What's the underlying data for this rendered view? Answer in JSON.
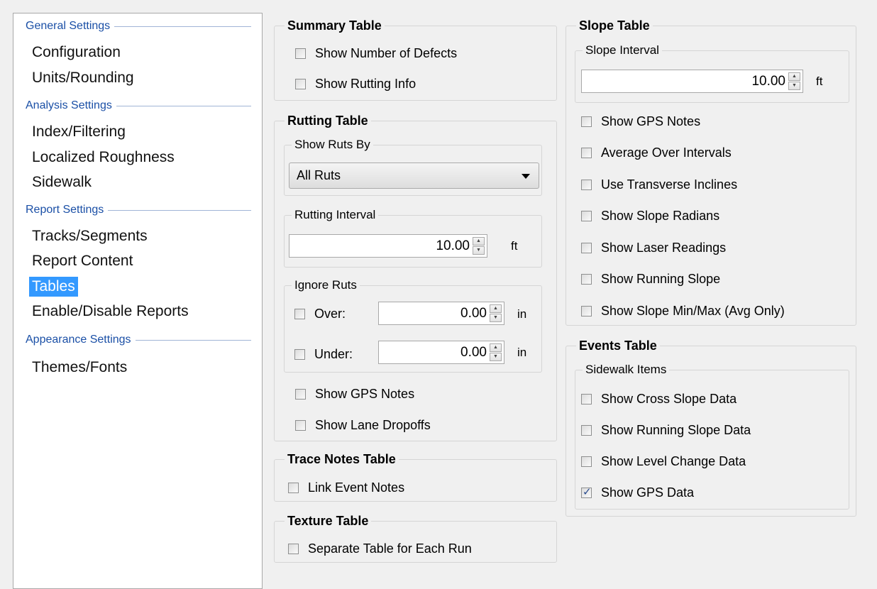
{
  "nav": {
    "sections": [
      {
        "heading": "General Settings",
        "items": [
          "Configuration",
          "Units/Rounding"
        ]
      },
      {
        "heading": "Analysis Settings",
        "items": [
          "Index/Filtering",
          "Localized Roughness",
          "Sidewalk"
        ]
      },
      {
        "heading": "Report Settings",
        "items": [
          "Tracks/Segments",
          "Report Content",
          "Tables",
          "Enable/Disable Reports"
        ]
      },
      {
        "heading": "Appearance Settings",
        "items": [
          "Themes/Fonts"
        ]
      }
    ],
    "selected": "Tables"
  },
  "summary": {
    "title": "Summary Table",
    "show_defects": "Show Number of Defects",
    "show_rutting": "Show Rutting Info"
  },
  "rutting": {
    "title": "Rutting Table",
    "show_by_title": "Show Ruts By",
    "show_by_value": "All Ruts",
    "interval_title": "Rutting Interval",
    "interval_value": "10.00",
    "interval_unit": "ft",
    "ignore_title": "Ignore Ruts",
    "over_label": "Over:",
    "over_value": "0.00",
    "over_unit": "in",
    "under_label": "Under:",
    "under_value": "0.00",
    "under_unit": "in",
    "show_gps": "Show GPS Notes",
    "show_dropoffs": "Show Lane Dropoffs"
  },
  "trace": {
    "title": "Trace Notes Table",
    "link_notes": "Link Event Notes"
  },
  "texture": {
    "title": "Texture Table",
    "separate": "Separate Table for Each Run"
  },
  "slope": {
    "title": "Slope Table",
    "interval_title": "Slope Interval",
    "interval_value": "10.00",
    "interval_unit": "ft",
    "items": [
      {
        "label": "Show GPS Notes",
        "checked": false
      },
      {
        "label": "Average Over Intervals",
        "checked": false
      },
      {
        "label": "Use Transverse Inclines",
        "checked": false
      },
      {
        "label": "Show Slope Radians",
        "checked": false
      },
      {
        "label": "Show Laser Readings",
        "checked": false
      },
      {
        "label": "Show Running Slope",
        "checked": false
      },
      {
        "label": "Show Slope Min/Max (Avg Only)",
        "checked": false
      }
    ]
  },
  "events": {
    "title": "Events Table",
    "sidewalk_title": "Sidewalk Items",
    "items": [
      {
        "label": "Show Cross Slope Data",
        "checked": false
      },
      {
        "label": "Show Running Slope Data",
        "checked": false
      },
      {
        "label": "Show Level Change Data",
        "checked": false
      },
      {
        "label": "Show GPS Data",
        "checked": true
      }
    ]
  },
  "check_mark": "✓",
  "colors": {
    "selection": "#3399ff",
    "heading": "#1a4fa6"
  }
}
